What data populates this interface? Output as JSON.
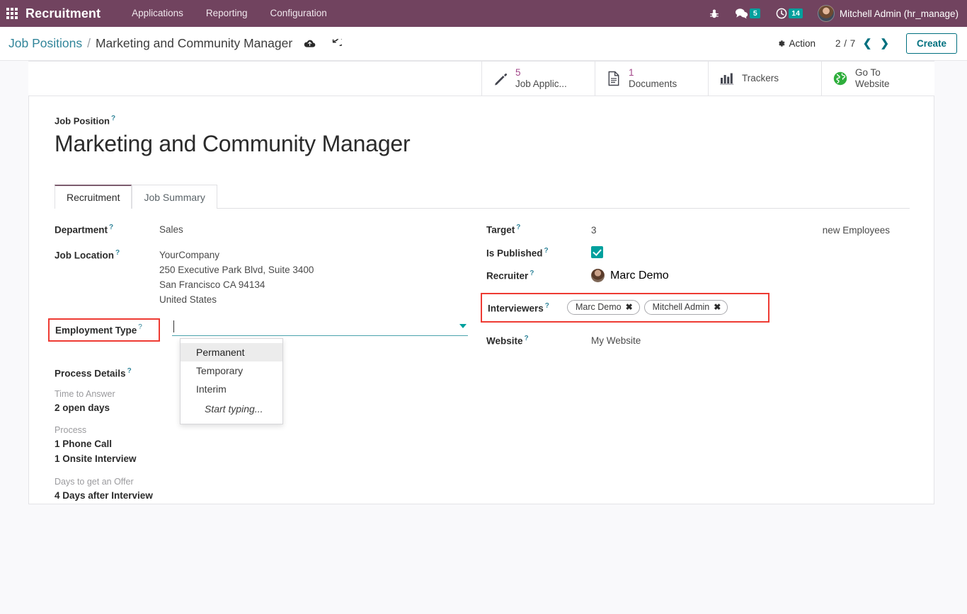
{
  "navbar": {
    "apps_icon": "apps-grid-icon",
    "brand": "Recruitment",
    "menu": [
      "Applications",
      "Reporting",
      "Configuration"
    ],
    "bug_icon": "bug-icon",
    "messages": {
      "icon": "chat-icon",
      "count": "5"
    },
    "activities": {
      "icon": "clock-icon",
      "count": "14"
    },
    "user": "Mitchell Admin (hr_manage)",
    "bg_color": "#71435f",
    "badge_color": "#00a09d"
  },
  "control_panel": {
    "breadcrumb_root": "Job Positions",
    "breadcrumb_sep": "/",
    "breadcrumb_current": "Marketing and Community Manager",
    "save_icon": "cloud-upload-icon",
    "discard_icon": "undo-icon",
    "action_label": "Action",
    "action_icon": "gear-icon",
    "pager": "2 / 7",
    "prev_icon": "chevron-left-icon",
    "next_icon": "chevron-right-icon",
    "create_label": "Create",
    "accent_color": "#00707f"
  },
  "stat_buttons": [
    {
      "icon": "pencil-icon",
      "count": "5",
      "label": "Job Applic..."
    },
    {
      "icon": "document-icon",
      "count": "1",
      "label": "Documents"
    },
    {
      "icon": "bar-chart-icon",
      "count": "",
      "label": "Trackers"
    },
    {
      "icon": "globe-icon",
      "count": "",
      "label": "Go To",
      "label2": "Website"
    }
  ],
  "form": {
    "title_label": "Job Position",
    "title": "Marketing and Community Manager",
    "help_marker": "?",
    "tabs": [
      {
        "label": "Recruitment",
        "active": true
      },
      {
        "label": "Job Summary",
        "active": false
      }
    ],
    "left": {
      "department_label": "Department",
      "department_value": "Sales",
      "job_location_label": "Job Location",
      "job_location_lines": [
        "YourCompany",
        "250 Executive Park Blvd, Suite 3400",
        "San Francisco CA 94134",
        "United States"
      ],
      "employment_type_label": "Employment Type",
      "employment_type_value": "",
      "employment_type_options": [
        "Permanent",
        "Temporary",
        "Interim"
      ],
      "employment_type_hint": "Start typing...",
      "employment_type_highlighted": true,
      "process_details_label": "Process Details",
      "process_groups": [
        {
          "caption": "Time to Answer",
          "lines": [
            "2 open days"
          ]
        },
        {
          "caption": "Process",
          "lines": [
            "1 Phone Call",
            "1 Onsite Interview"
          ]
        },
        {
          "caption": "Days to get an Offer",
          "lines": [
            "4 Days after Interview"
          ]
        }
      ]
    },
    "right": {
      "target_label": "Target",
      "target_value": "3",
      "target_suffix": "new Employees",
      "is_published_label": "Is Published",
      "is_published_checked": true,
      "recruiter_label": "Recruiter",
      "recruiter_value": "Marc Demo",
      "interviewers_label": "Interviewers",
      "interviewers": [
        "Marc Demo",
        "Mitchell Admin"
      ],
      "interviewers_highlighted": true,
      "tag_remove_icon": "close-icon",
      "website_label": "Website",
      "website_value": "My Website"
    }
  },
  "highlight_color": "#ee3b33"
}
